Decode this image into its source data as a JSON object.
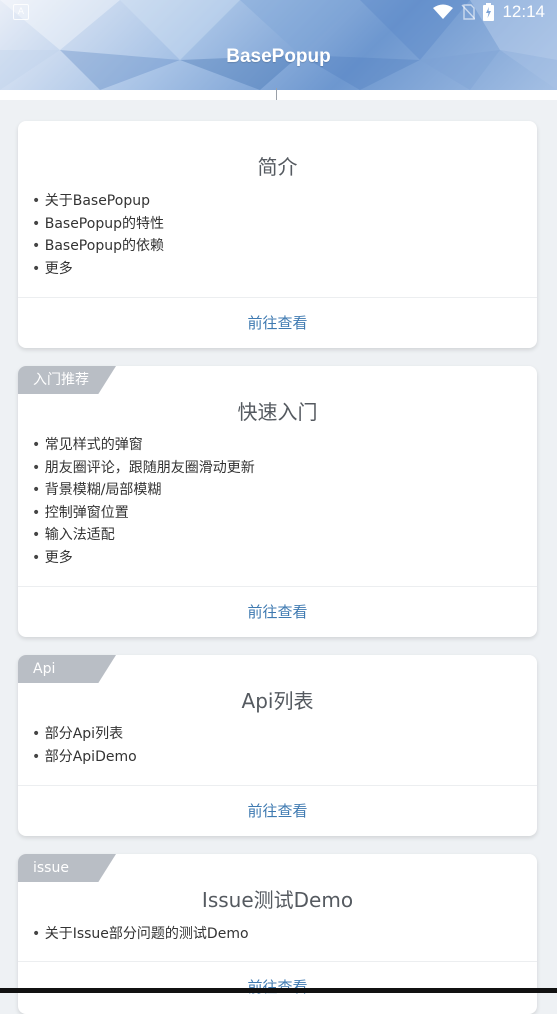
{
  "status_bar": {
    "time": "12:14",
    "left_icon": "A",
    "icons": [
      "wifi-icon",
      "no-sim-icon",
      "battery-charging-icon"
    ]
  },
  "header": {
    "title": "BasePopup"
  },
  "cards": [
    {
      "tag": "",
      "title": "简介",
      "items": [
        "关于BasePopup",
        "BasePopup的特性",
        "BasePopup的依赖",
        "更多"
      ],
      "action": "前往查看"
    },
    {
      "tag": "入门推荐",
      "title": "快速入门",
      "items": [
        "常见样式的弹窗",
        "朋友圈评论，跟随朋友圈滑动更新",
        "背景模糊/局部模糊",
        "控制弹窗位置",
        "输入法适配",
        "更多"
      ],
      "action": "前往查看"
    },
    {
      "tag": "Api",
      "title": "Api列表",
      "items": [
        "部分Api列表",
        "部分ApiDemo"
      ],
      "action": "前往查看"
    },
    {
      "tag": "issue",
      "title": "Issue测试Demo",
      "items": [
        "关于Issue部分问题的测试Demo"
      ],
      "action": "前往查看"
    }
  ],
  "colors": {
    "accent": "#3f7ab1",
    "tag_bg": "#b9bec5",
    "page_bg": "#eef1f4"
  }
}
